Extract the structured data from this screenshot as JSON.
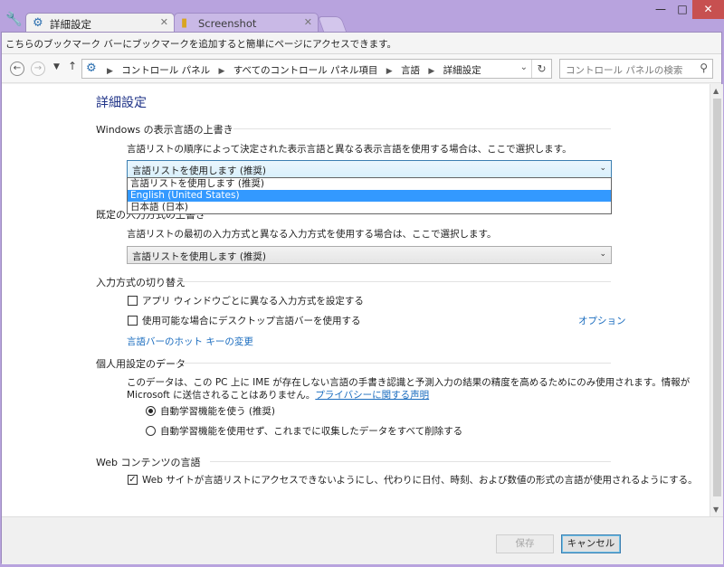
{
  "window": {
    "tabs": [
      {
        "label": "詳細設定",
        "icon": "control-panel-icon"
      },
      {
        "label": "Screenshot",
        "icon": "folder-icon"
      }
    ],
    "controls": {
      "minimize": "—",
      "maximize": "□",
      "close": "✕"
    }
  },
  "bookmark_bar": {
    "text": "こちらのブックマーク バーにブックマークを追加すると簡単にページにアクセスできます。"
  },
  "address_bar": {
    "breadcrumbs": [
      "コントロール パネル",
      "すべてのコントロール パネル項目",
      "言語",
      "詳細設定"
    ],
    "search_placeholder": "コントロール パネルの検索"
  },
  "page": {
    "title": "詳細設定",
    "display_language": {
      "heading": "Windows の表示言語の上書き",
      "description": "言語リストの順序によって決定された表示言語と異なる表示言語を使用する場合は、ここで選択します。",
      "selected": "言語リストを使用します (推奨)",
      "options": [
        "言語リストを使用します (推奨)",
        "English (United States)",
        "日本語 (日本)"
      ],
      "highlighted_option": "English (United States)"
    },
    "input_method": {
      "heading": "既定の入力方式の上書き",
      "description": "言語リストの最初の入力方式と異なる入力方式を使用する場合は、ここで選択します。",
      "selected": "言語リストを使用します (推奨)"
    },
    "switching": {
      "heading": "入力方式の切り替え",
      "checkbox1": "アプリ ウィンドウごとに異なる入力方式を設定する",
      "checkbox1_checked": false,
      "checkbox2": "使用可能な場合にデスクトップ言語バーを使用する",
      "checkbox2_checked": false,
      "options_link": "オプション",
      "hotkey_link": "言語バーのホット キーの変更"
    },
    "personalization": {
      "heading": "個人用設定のデータ",
      "description_line1": "このデータは、この PC 上に IME が存在しない言語の手書き認識と予測入力の結果の精度を高めるためにのみ使用されます。情報が",
      "description_line2": "Microsoft に送信されることはありません。",
      "privacy_link": "プライバシーに関する声明",
      "radio1": "自動学習機能を使う (推奨)",
      "radio2": "自動学習機能を使用せず、これまでに収集したデータをすべて削除する",
      "radio_selected": 1
    },
    "web_content": {
      "heading": "Web コンテンツの言語",
      "checkbox": "Web サイトが言語リストにアクセスできないようにし、代わりに日付、時刻、および数値の形式の言語が使用されるようにする。",
      "checkbox_checked": true
    }
  },
  "footer": {
    "save": "保存",
    "cancel": "キャンセル"
  }
}
